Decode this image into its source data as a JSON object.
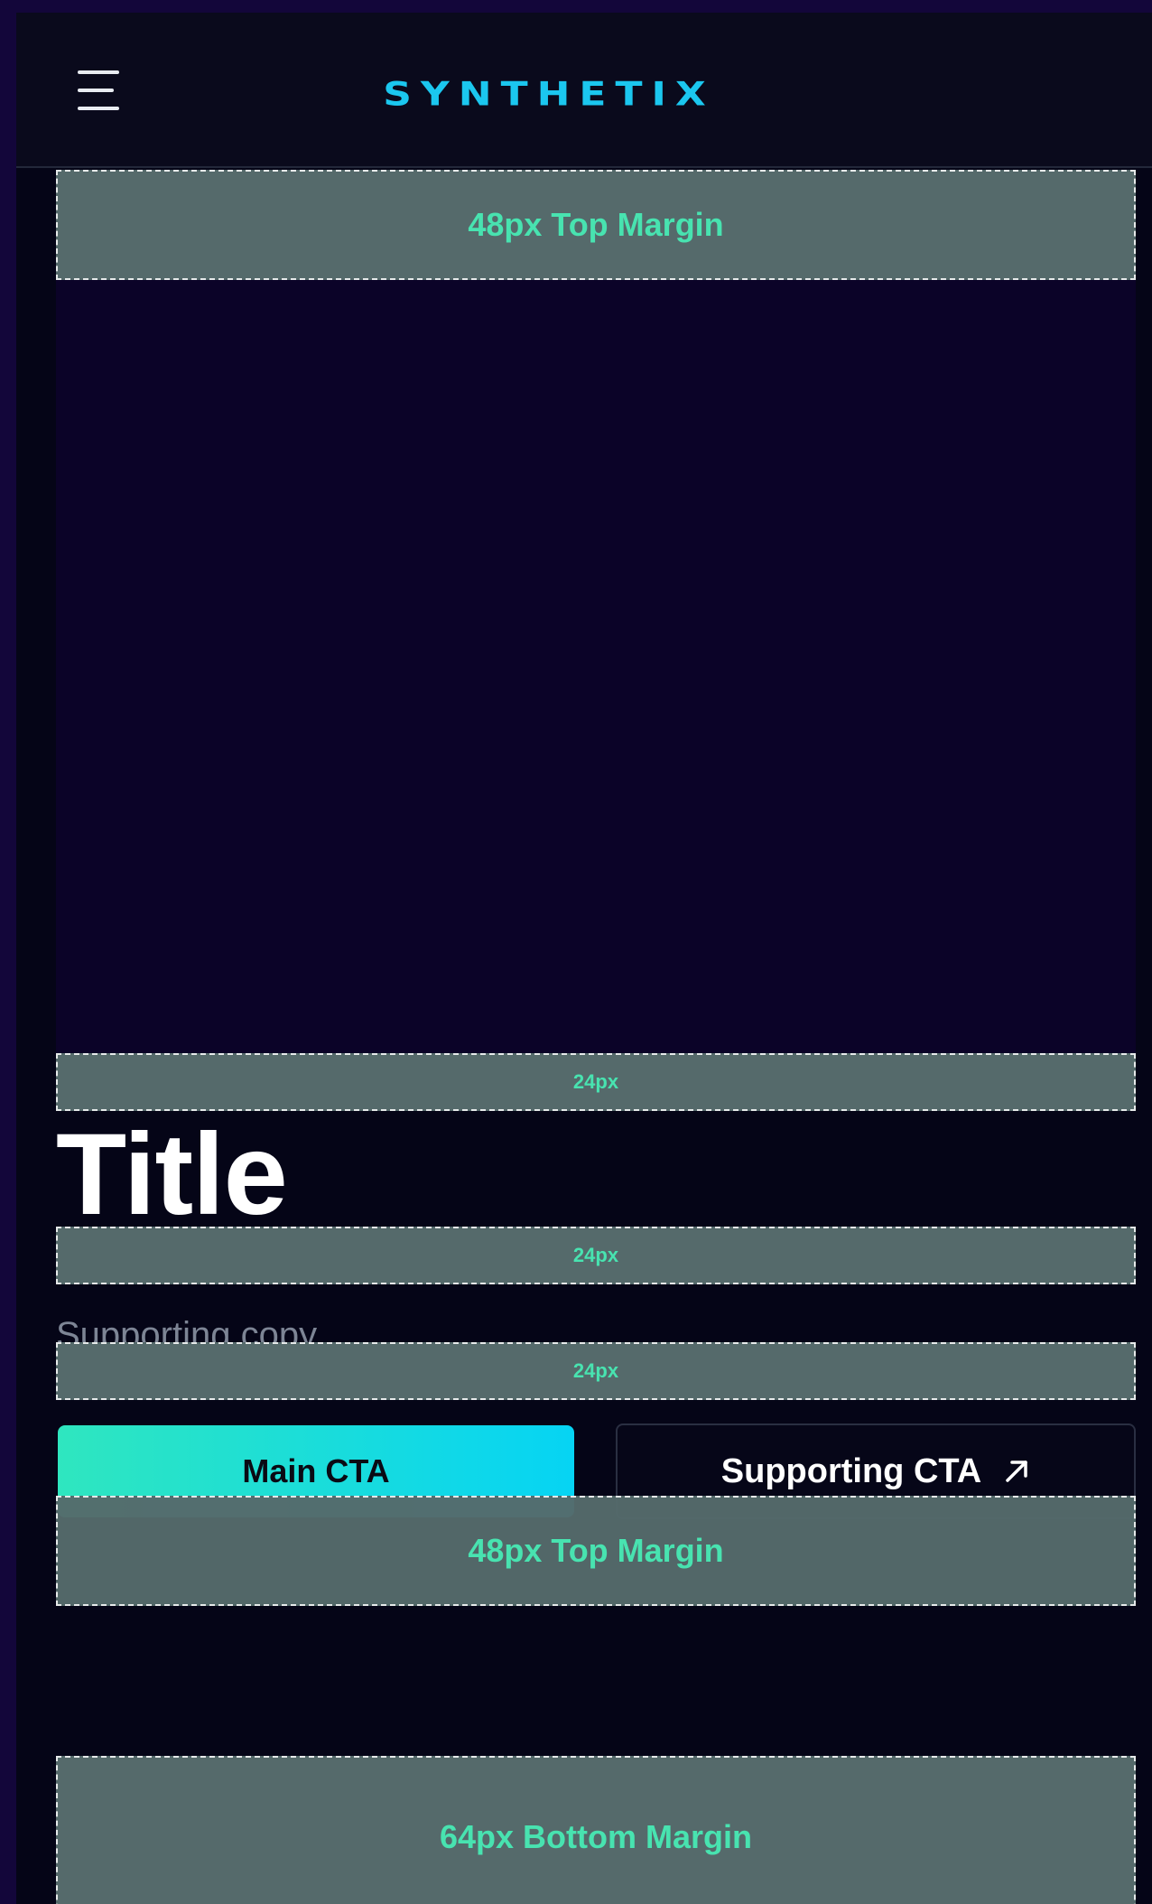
{
  "header": {
    "logo": "SYNTHETIX",
    "menu_icon": "hamburger-menu-icon"
  },
  "spacers": {
    "top_margin_1": "48px Top Margin",
    "gap_1": "24px",
    "gap_2": "24px",
    "gap_3": "24px",
    "top_margin_2": "48px Top Margin",
    "bottom_margin": "64px Bottom Margin"
  },
  "content": {
    "title": "Title",
    "supporting_copy": "Supporting copy"
  },
  "cta": {
    "main_label": "Main CTA",
    "supporting_label": "Supporting CTA",
    "supporting_icon": "external-arrow-icon"
  },
  "colors": {
    "background": "#050517",
    "header_bg": "#0a0a1c",
    "brand": "#1bc7ef",
    "spacer_bg": "#556a6b",
    "spacer_text": "#48e3b0",
    "cta_gradient_start": "#2fe6bf",
    "cta_gradient_end": "#06d4f4"
  }
}
